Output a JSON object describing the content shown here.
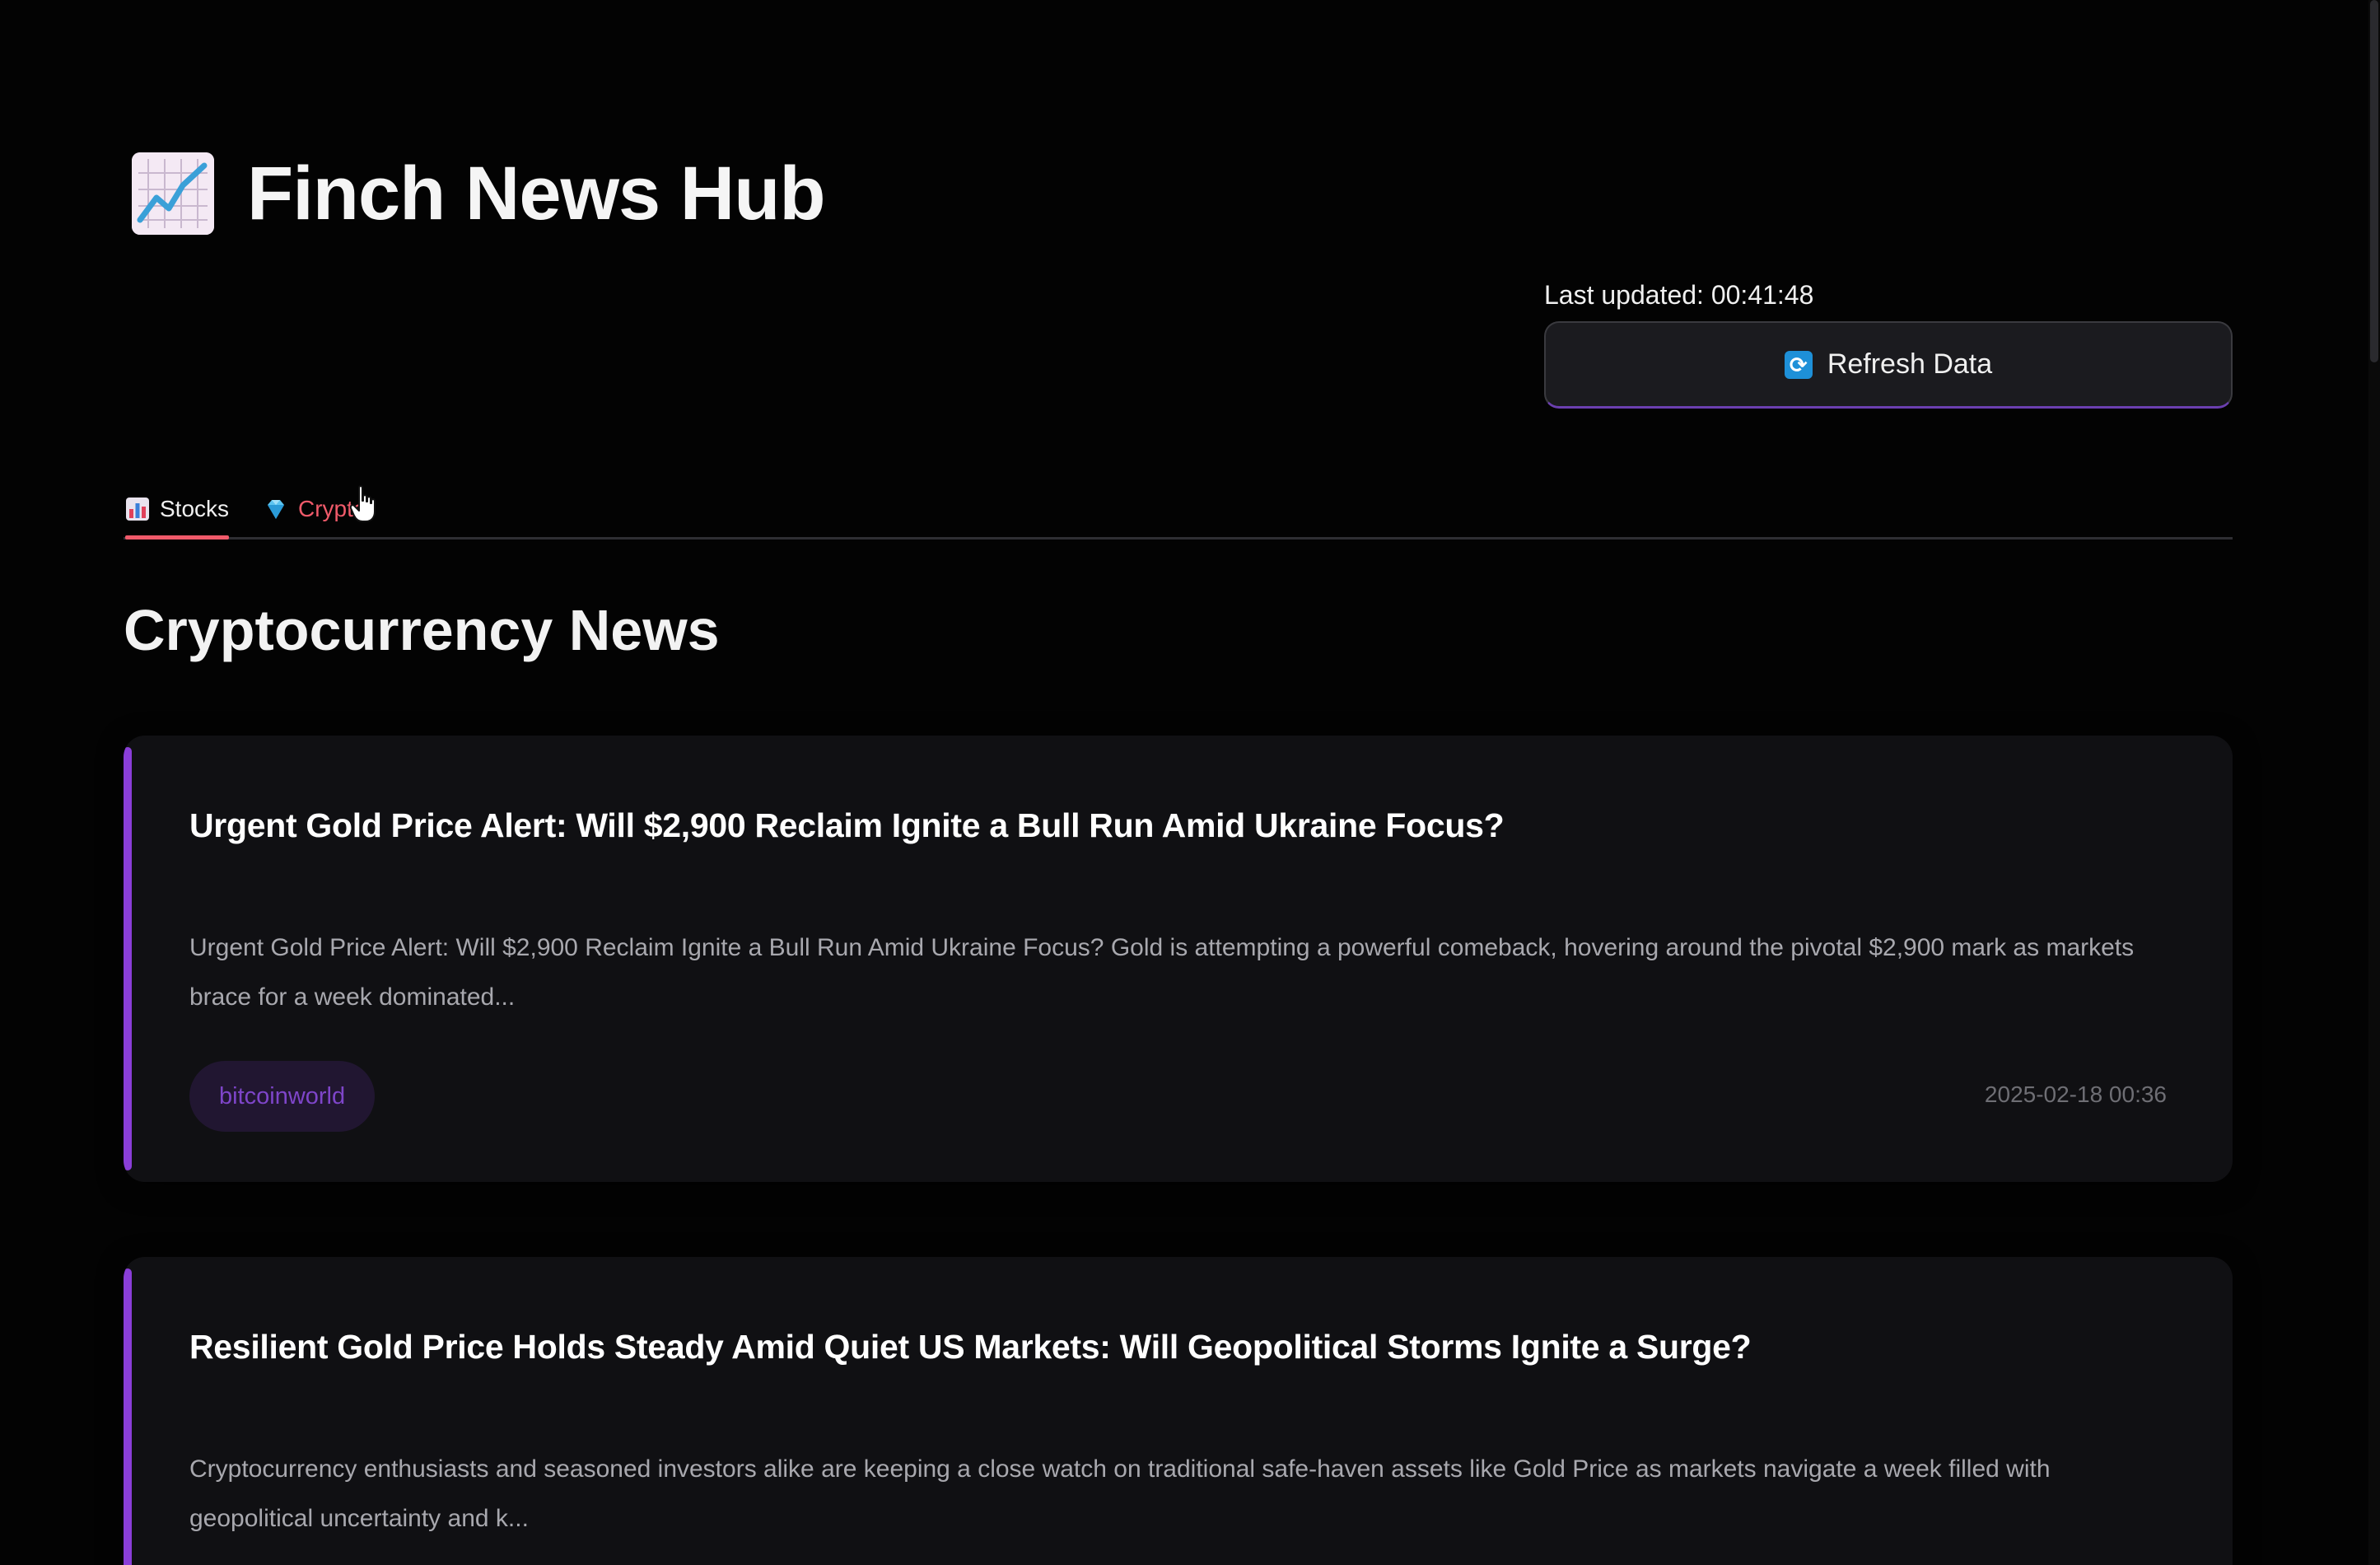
{
  "app": {
    "title": "Finch News Hub",
    "icon": "chart-increasing-icon"
  },
  "header": {
    "last_updated": "Last updated: 00:41:48",
    "refresh_label": "Refresh Data",
    "refresh_icon": "refresh-icon"
  },
  "tabs": [
    {
      "label": "Stocks",
      "icon": "bar-chart-icon",
      "active": true
    },
    {
      "label": "Crypto",
      "icon": "gem-icon",
      "active": false
    }
  ],
  "section": {
    "title": "Cryptocurrency News"
  },
  "articles": [
    {
      "title": "Urgent Gold Price Alert: Will $2,900 Reclaim Ignite a Bull Run Amid Ukraine Focus?",
      "summary": "Urgent Gold Price Alert: Will $2,900 Reclaim Ignite a Bull Run Amid Ukraine Focus? Gold is attempting a powerful comeback, hovering around the pivotal $2,900 mark as markets brace for a week dominated...",
      "source": "bitcoinworld",
      "date": "2025-02-18 00:36"
    },
    {
      "title": "Resilient Gold Price Holds Steady Amid Quiet US Markets: Will Geopolitical Storms Ignite a Surge?",
      "summary": "Cryptocurrency enthusiasts and seasoned investors alike are keeping a close watch on traditional safe-haven assets like Gold Price as markets navigate a week filled with geopolitical uncertainty and k..."
    }
  ],
  "colors": {
    "background": "#030303",
    "accent_purple": "#8a3ed8",
    "tab_active_red": "#f05a6a",
    "card_background": "#101013",
    "refresh_icon_blue": "#1e90d8"
  }
}
